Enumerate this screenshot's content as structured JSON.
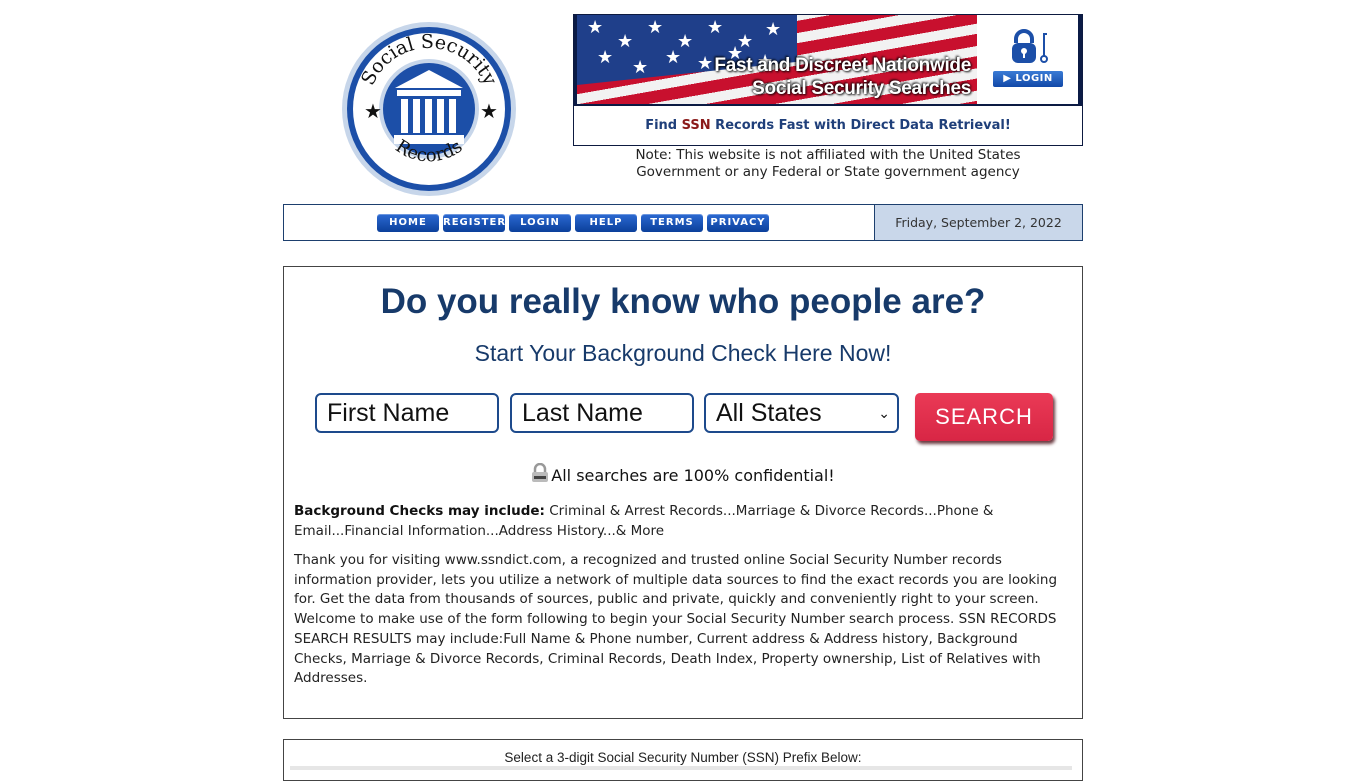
{
  "logo": {
    "top_text": "Social Security",
    "bottom_text": "Records"
  },
  "banner": {
    "headline_line1": "Fast and Discreet Nationwide",
    "headline_line2": "Social Security Searches",
    "login_label": "▶ LOGIN",
    "tagline_before": "Find ",
    "tagline_highlight": "SSN",
    "tagline_after": " Records Fast with Direct Data Retrieval!"
  },
  "note": {
    "line1": "Note: This website is not affiliated with the United States",
    "line2": "Government or any Federal or State government agency"
  },
  "nav": {
    "items": [
      {
        "label": "HOME"
      },
      {
        "label": "REGISTER"
      },
      {
        "label": "LOGIN"
      },
      {
        "label": "HELP"
      },
      {
        "label": "TERMS"
      },
      {
        "label": "PRIVACY"
      }
    ],
    "date": "Friday, September 2, 2022"
  },
  "main": {
    "headline": "Do you really know who people are?",
    "subheadline": "Start Your Background Check Here Now!",
    "form": {
      "first_name_placeholder": "First Name",
      "last_name_placeholder": "Last Name",
      "state_selected": "All States",
      "search_label": "SEARCH"
    },
    "confidential": "All searches are 100% confidential!",
    "background_label": "Background Checks may include:",
    "background_items": " Criminal & Arrest Records...Marriage & Divorce Records...Phone & Email...Financial Information...Address History...& More",
    "intro": "Thank you for visiting www.ssndict.com, a recognized and trusted online Social Security Number records information provider, lets you utilize a network of multiple data sources to find the exact records you are looking for. Get the data from thousands of sources, public and private, quickly and conveniently right to your screen. Welcome to make use of the form following to begin your Social Security Number search process. SSN RECORDS SEARCH RESULTS may include:Full Name & Phone number, Current address & Address history, Background Checks, Marriage & Divorce Records, Criminal Records, Death Index, Property ownership, List of Relatives with Addresses."
  },
  "prefix_section": {
    "label": "Select a 3-digit Social Security Number (SSN) Prefix Below:"
  },
  "colors": {
    "brand_blue": "#173a6a",
    "nav_button": "#0b3f9a",
    "search_red": "#d82645",
    "date_bg": "#c9d7ea"
  }
}
